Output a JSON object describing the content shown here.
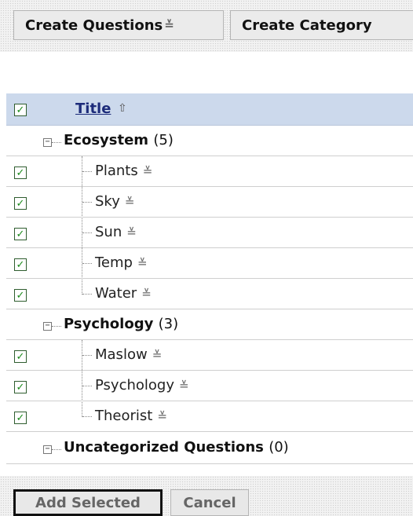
{
  "toolbar": {
    "create_questions_label": "Create Questions",
    "create_category_label": "Create Category"
  },
  "table": {
    "header_title": "Title",
    "categories": [
      {
        "name": "Ecosystem",
        "count": "(5)",
        "questions": [
          "Plants",
          "Sky",
          "Sun",
          "Temp",
          "Water"
        ]
      },
      {
        "name": "Psychology",
        "count": "(3)",
        "questions": [
          "Maslow",
          "Psychology",
          "Theorist"
        ]
      },
      {
        "name": "Uncategorized Questions",
        "count": "(0)",
        "questions": []
      }
    ]
  },
  "footer": {
    "add_selected_label": "Add Selected",
    "cancel_label": "Cancel"
  },
  "colors": {
    "header_row_bg": "#ccd9ec",
    "link": "#1c2b7a",
    "checkmark": "#1a8a1a"
  },
  "icons": {
    "checkbox_checked": "checkbox-checked-icon",
    "sort": "sort-ascending-icon",
    "item_menu": "dropdown-menu-icon",
    "collapse": "tree-collapse-icon"
  }
}
